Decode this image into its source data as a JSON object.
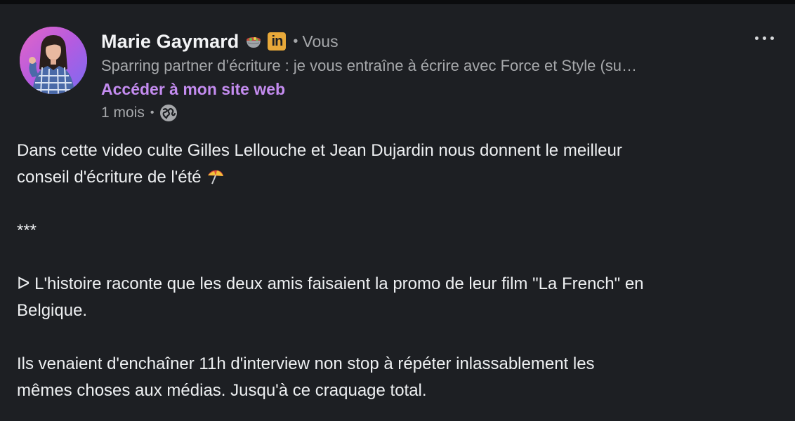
{
  "post": {
    "author": {
      "name": "Marie Gaymard",
      "badge_icon": "mixing-bowl-emoji-icon",
      "linkedin_icon_text": "in",
      "separator": "•",
      "relation": "Vous",
      "headline": "Sparring partner d’écriture : je vous entraîne à écrire avec Force et Style (su…",
      "website_link": "Accéder à mon site web"
    },
    "meta": {
      "time": "1 mois",
      "separator": "•",
      "visibility_icon": "globe-icon"
    },
    "more_icon": "more-options-icon",
    "body": {
      "line1": "Dans cette video culte Gilles Lellouche et Jean Dujardin nous donnent le meilleur",
      "line2": "conseil d'écriture de l'été",
      "line2_emoji": "beach-umbrella-emoji",
      "stars": "***",
      "para2_line1": "ᐅ L'histoire raconte que les deux amis faisaient la promo de leur film \"La French\" en",
      "para2_line2": "Belgique.",
      "para3_line1": "Ils venaient d'enchaîner 11h d'interview non stop à répéter inlassablement les",
      "para3_line2": "mêmes choses aux médias. Jusqu'à ce craquage total."
    },
    "colors": {
      "background": "#1d1f23",
      "link": "#c48cf0",
      "muted": "#a6a8ab",
      "text": "#eef0f2",
      "linkedin_badge": "#e8a93a"
    }
  }
}
